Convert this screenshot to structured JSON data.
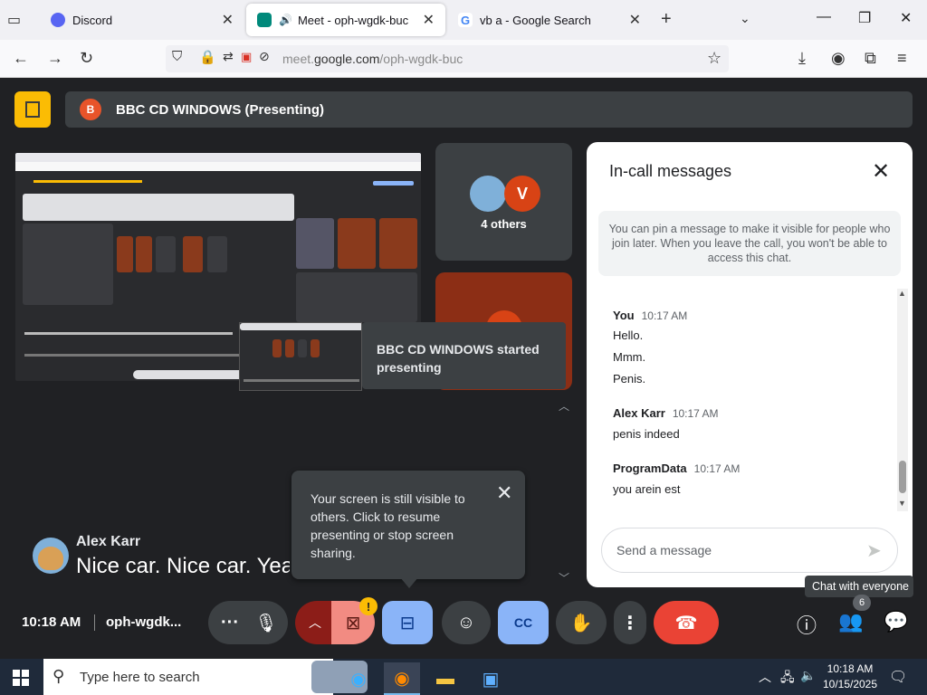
{
  "browser": {
    "tabs": [
      {
        "title": "Discord",
        "color": "#5865f2"
      },
      {
        "title": "Meet - oph-wgdk-buc",
        "color": "#00897b"
      },
      {
        "title": "vb a - Google Search",
        "color": "#4285f4"
      }
    ],
    "url_prefix": "meet.",
    "url_domain": "google.com",
    "url_path": "/oph-wgdk-buc"
  },
  "meet": {
    "presenter_initial": "B",
    "banner_text": "BBC CD WINDOWS (Presenting)",
    "others_initial": "V",
    "others_label": "4 others",
    "toast": "BBC CD WINDOWS started presenting",
    "caption_name": "Alex Karr",
    "caption_text": "Nice car. Nice car. Yea",
    "popup_text": "Your screen is still visible to others. Click to resume presenting or stop screen sharing.",
    "time": "10:18 AM",
    "meeting_code": "oph-wgdk...",
    "warning_badge": "!",
    "tooltip": "Chat with everyone",
    "people_count": "6"
  },
  "chat": {
    "title": "In-call messages",
    "info": "You can pin a message to make it visible for people who join later. When you leave the call, you won't be able to access this chat.",
    "groups": [
      {
        "sender": "You",
        "time": "10:17 AM",
        "messages": [
          "Hello.",
          "Mmm.",
          "Penis."
        ]
      },
      {
        "sender": "Alex Karr",
        "time": "10:17 AM",
        "messages": [
          "penis indeed"
        ]
      },
      {
        "sender": "ProgramData",
        "time": "10:17 AM",
        "messages": [
          "you arein est"
        ]
      }
    ],
    "input_placeholder": "Send a message"
  },
  "taskbar": {
    "search_placeholder": "Type here to search",
    "clock_time": "10:18 AM",
    "clock_date": "10/15/2025"
  },
  "colors": {
    "end_call": "#ea4335",
    "active_btn": "#8ab4f8",
    "cam_off": "#f28b82",
    "meet_bg": "#202124"
  }
}
